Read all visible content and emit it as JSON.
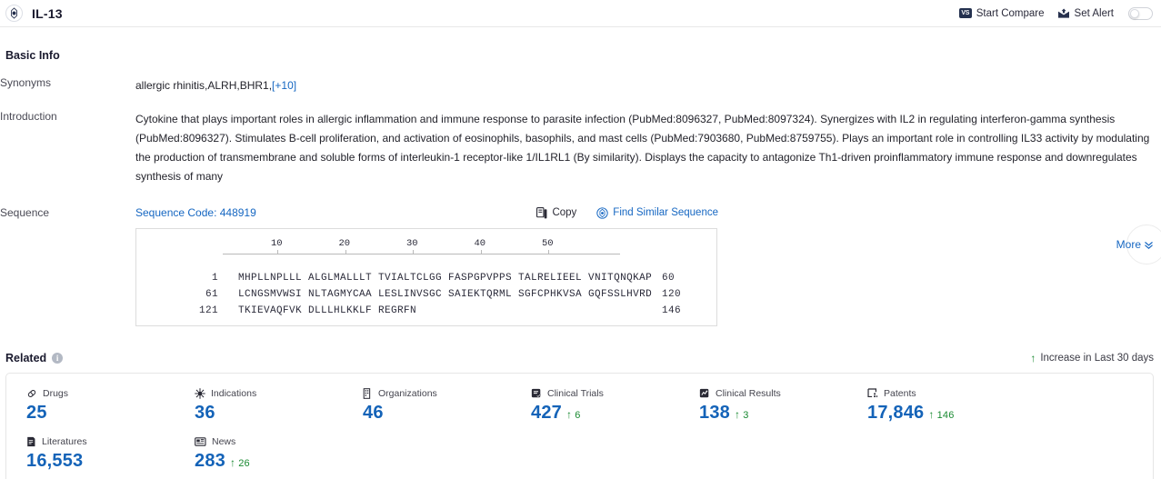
{
  "header": {
    "entity_title": "IL-13",
    "logo_icon": "target-circle-icon",
    "start_compare_label": "Start Compare",
    "vs_badge_text": "VS",
    "set_alert_label": "Set Alert",
    "alert_toggle_state": "off"
  },
  "basic_info": {
    "section_title": "Basic Info",
    "synonyms_label": "Synonyms",
    "synonyms_value": "allergic rhinitis,ALRH,BHR1,",
    "synonyms_more": "[+10]",
    "introduction_label": "Introduction",
    "introduction_parts": [
      {
        "t": "Cytokine that plays important roles in allergic inflammation and immune response to parasite infection (PubMed:"
      },
      {
        "t": "8096327",
        "link": true
      },
      {
        "t": ", PubMed:"
      },
      {
        "t": "8097324",
        "link": true
      },
      {
        "t": "). Synergizes with IL2 in regulating interferon-gamma synthesis (PubMed:"
      },
      {
        "t": "8096327",
        "link": true
      },
      {
        "t": "). Stimulates B-cell proliferation, and activation of eosinophils, basophils, and mast cells (PubMed:"
      },
      {
        "t": "7903680",
        "link": true
      },
      {
        "t": ", PubMed:"
      },
      {
        "t": "8759755",
        "link": true
      },
      {
        "t": "). Plays an important role in controlling IL33 activity by modulating the production of transmembrane and soluble forms of interleukin-1 receptor-like 1/IL1RL1 (By similarity). Displays the capacity to antagonize Th1-driven proinflammatory immune response and downregulates synthesis of many"
      }
    ],
    "more_label": "More",
    "more_icon": "chevron-double-down-icon"
  },
  "sequence": {
    "label": "Sequence",
    "code_label": "Sequence Code: 448919",
    "copy_label": "Copy",
    "copy_icon": "copy-icon",
    "find_similar_label": "Find Similar Sequence",
    "find_similar_icon": "target-circle-icon",
    "ruler_ticks": [
      "10",
      "20",
      "30",
      "40",
      "50"
    ],
    "rows": [
      {
        "start": "1",
        "residues": "MHPLLNPLLL ALGLMALLLT TVIALTCLGG FASPGPVPPS TALRELIEEL VNITQNQKAP",
        "end": "60"
      },
      {
        "start": "61",
        "residues": "LCNGSMVWSI NLTAGMYCAA LESLINVSGC SAIEKTQRML SGFCPHKVSA GQFSSLHVRD",
        "end": "120"
      },
      {
        "start": "121",
        "residues": "TKIEVAQFVK DLLLHLKKLF REGRFN",
        "end": "146"
      }
    ]
  },
  "related": {
    "title": "Related",
    "info_icon": "info-icon",
    "info_glyph": "i",
    "legend_label": "Increase in Last 30 days",
    "legend_arrow": "↑",
    "stats": [
      {
        "label": "Drugs",
        "icon": "pill-icon",
        "value": "25",
        "delta": null
      },
      {
        "label": "Indications",
        "icon": "virus-icon",
        "value": "36",
        "delta": null
      },
      {
        "label": "Organizations",
        "icon": "building-icon",
        "value": "46",
        "delta": null
      },
      {
        "label": "Clinical Trials",
        "icon": "clinical-trial-icon",
        "value": "427",
        "delta": "6"
      },
      {
        "label": "Clinical Results",
        "icon": "clinical-result-icon",
        "value": "138",
        "delta": "3"
      },
      {
        "label": "Patents",
        "icon": "patent-icon",
        "value": "17,846",
        "delta": "146"
      },
      {
        "label": "Literatures",
        "icon": "literature-icon",
        "value": "16,553",
        "delta": null
      },
      {
        "label": "News",
        "icon": "news-icon",
        "value": "283",
        "delta": "26"
      }
    ]
  },
  "colors": {
    "link_blue": "#1667c2",
    "stat_blue": "#1463b8",
    "increase_green": "#1a8a32",
    "dark_navy": "#24314f"
  }
}
